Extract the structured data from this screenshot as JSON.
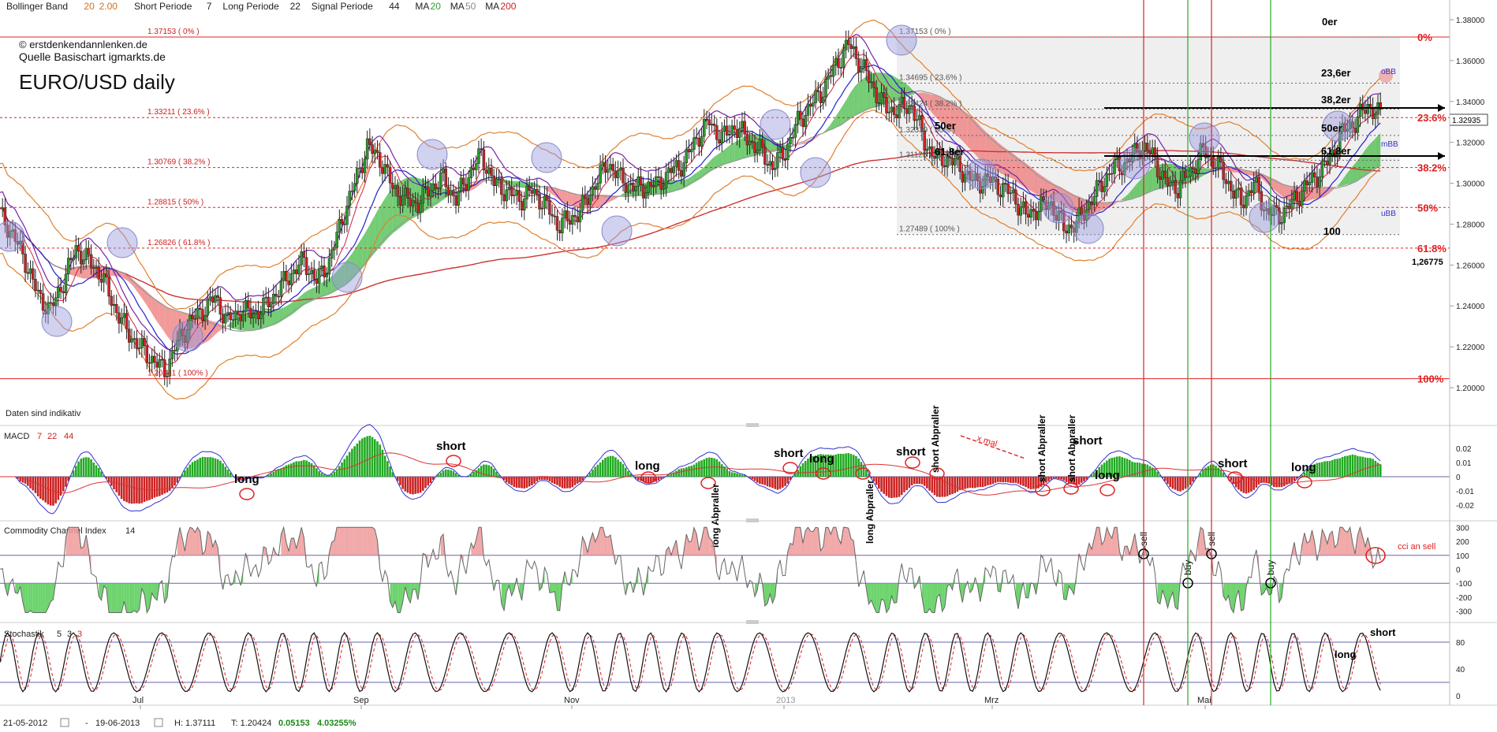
{
  "header": {
    "bollinger": {
      "label": "Bollinger Band",
      "p1": "20",
      "p2": "2.00"
    },
    "short_periode": {
      "label": "Short Periode",
      "value": "7"
    },
    "long_periode": {
      "label": "Long Periode",
      "value": "22"
    },
    "signal_periode": {
      "label": "Signal Periode",
      "value": "44"
    },
    "ma": [
      {
        "label": "MA",
        "value": "20",
        "color": "#2e9e2e"
      },
      {
        "label": "MA",
        "value": "50",
        "color": "#888888"
      },
      {
        "label": "MA",
        "value": "200",
        "color": "#cc2222"
      }
    ]
  },
  "watermark": {
    "copyright": "© erstdenkendannlenken.de",
    "source": "Quelle Basischart igmarkts.de",
    "title": "EURO/USD daily"
  },
  "disclaimer": "Daten sind indikativ",
  "panels": {
    "macd": {
      "label": "MACD",
      "p1": "7",
      "p2": "22",
      "p3": "44"
    },
    "cci": {
      "label": "Commodity Channel Index",
      "p1": "14"
    },
    "stoch": {
      "label": "Stochastik",
      "p1": "5",
      "p2": "3",
      "p3": "3"
    }
  },
  "footer": {
    "from_date": "21-05-2012",
    "dash": "-",
    "to_date": "19-06-2013",
    "high": "H: 1.37111",
    "low": "T: 1.20424",
    "change": "0.05153",
    "change_pct": "4.03255%"
  },
  "chart_data": [
    {
      "type": "candlestick",
      "title": "EURO/USD daily",
      "x_labels": [
        "Jul",
        "Sep",
        "Nov",
        "2013",
        "Mrz",
        "Mai"
      ],
      "y_ticks": [
        "1.38000",
        "1.36000",
        "1.34000",
        "1.32000",
        "1.30000",
        "1.28000",
        "1.26000",
        "1.24000",
        "1.22000",
        "1.20000"
      ],
      "y_tick_values": [
        1.38,
        1.36,
        1.34,
        1.32,
        1.3,
        1.28,
        1.26,
        1.24,
        1.22,
        1.2
      ],
      "ylim": [
        1.195,
        1.385
      ],
      "current_price": "1.32935",
      "fib_main": [
        {
          "label": "1.37153 ( 0% )",
          "value": 1.37153,
          "right_label": "0%"
        },
        {
          "label": "1.33211 ( 23.6% )",
          "value": 1.33211,
          "right_label": "23.6%"
        },
        {
          "label": "1.30769 ( 38.2% )",
          "value": 1.30769,
          "right_label": "38.2%"
        },
        {
          "label": "1.28815 ( 50% )",
          "value": 1.28815,
          "right_label": "50%"
        },
        {
          "label": "1.26826 ( 61.8% )",
          "value": 1.26826,
          "right_label": "61.8%"
        },
        {
          "label": "1.20441 ( 100% )",
          "value": 1.20441,
          "right_label": "100%"
        }
      ],
      "fib_inner": [
        {
          "label": "1.37153 ( 0% )",
          "value": 1.37153
        },
        {
          "label": "1.34695 ( 23.6% )",
          "value": 1.34895
        },
        {
          "label": "1.33424 ( 38.2% )",
          "value": 1.33624
        },
        {
          "label": "1.32339 ( 50% )",
          "value": 1.32339
        },
        {
          "label": "1.31125 ( 61.8% )",
          "value": 1.31125
        },
        {
          "label": "1.27489 ( 100% )",
          "value": 1.27489
        }
      ],
      "annotations": [
        "0er",
        "23,6er",
        "38,2er",
        "50er",
        "61,8er",
        "50er",
        "61,8er",
        "100",
        "oBB",
        "mBB",
        "uBB",
        "1,26775"
      ],
      "close_series": [
        1.285,
        1.275,
        1.262,
        1.245,
        1.238,
        1.252,
        1.268,
        1.262,
        1.255,
        1.24,
        1.228,
        1.22,
        1.214,
        1.208,
        1.222,
        1.232,
        1.238,
        1.244,
        1.232,
        1.238,
        1.236,
        1.24,
        1.248,
        1.256,
        1.262,
        1.252,
        1.262,
        1.282,
        1.3,
        1.318,
        1.312,
        1.298,
        1.292,
        1.29,
        1.298,
        1.302,
        1.292,
        1.304,
        1.314,
        1.3,
        1.296,
        1.292,
        1.296,
        1.29,
        1.28,
        1.282,
        1.288,
        1.3,
        1.31,
        1.302,
        1.298,
        1.298,
        1.3,
        1.306,
        1.31,
        1.322,
        1.33,
        1.322,
        1.328,
        1.322,
        1.316,
        1.308,
        1.316,
        1.33,
        1.338,
        1.346,
        1.358,
        1.368,
        1.358,
        1.346,
        1.336,
        1.336,
        1.338,
        1.32,
        1.312,
        1.312,
        1.306,
        1.3,
        1.302,
        1.298,
        1.294,
        1.284,
        1.288,
        1.29,
        1.278,
        1.28,
        1.29,
        1.3,
        1.308,
        1.31,
        1.318,
        1.314,
        1.3,
        1.298,
        1.306,
        1.316,
        1.31,
        1.3,
        1.29,
        1.3,
        1.286,
        1.284,
        1.29,
        1.298,
        1.304,
        1.312,
        1.325,
        1.33,
        1.338,
        1.333
      ]
    },
    {
      "type": "histogram",
      "title": "MACD",
      "y_ticks": [
        "0.02",
        "0.01",
        "0",
        "-0.01",
        "-0.02"
      ],
      "ylim": [
        -0.025,
        0.025
      ],
      "signals": [
        "long",
        "short",
        "long",
        "short",
        "long",
        "short",
        "long",
        "short",
        "long",
        "short",
        "long"
      ],
      "vertical_labels": [
        "long Abpraller",
        "long Abpraller",
        "short Abpraller",
        "short Abpraller",
        "short Abpraller"
      ],
      "note": "x mal"
    },
    {
      "type": "line",
      "title": "Commodity Channel Index 14",
      "y_ticks": [
        "300",
        "200",
        "100",
        "0",
        "-100",
        "-200",
        "-300"
      ],
      "ylim": [
        -330,
        330
      ],
      "signals": [
        "sell",
        "buy",
        "sell",
        "buy"
      ],
      "note": "cci an sell"
    },
    {
      "type": "line",
      "title": "Stochastik 5 3 3",
      "y_ticks": [
        "80",
        "40",
        "0"
      ],
      "ylim": [
        0,
        100
      ],
      "signals": [
        "short",
        "long"
      ]
    }
  ]
}
